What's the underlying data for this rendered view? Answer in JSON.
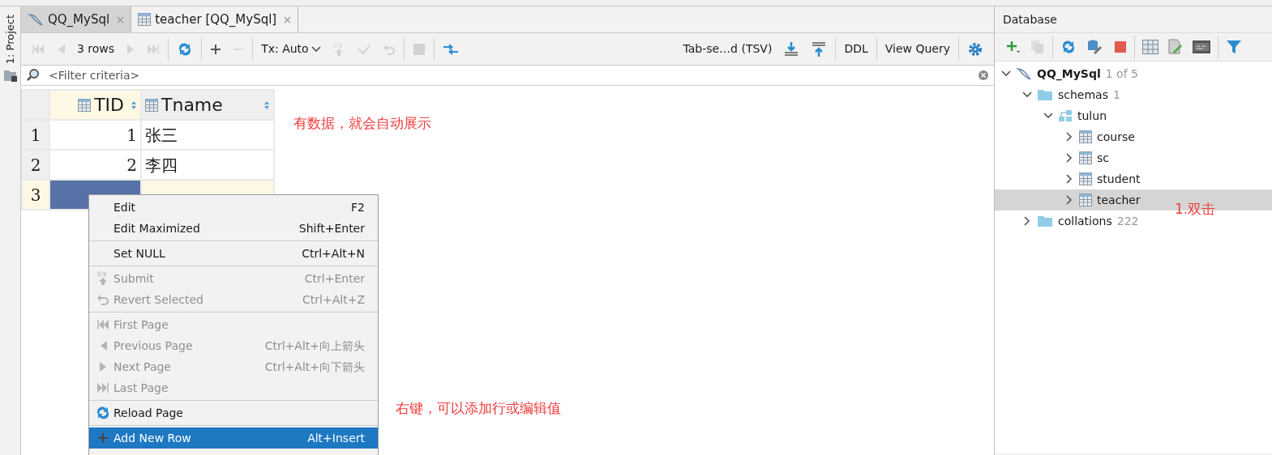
{
  "side_strip": {
    "label": "1: Project"
  },
  "editor_tabs": [
    {
      "label": "QQ_MySql",
      "kind": "datasource",
      "selected": false
    },
    {
      "label": "teacher [QQ_MySql]",
      "kind": "table",
      "selected": true
    }
  ],
  "toolbar": {
    "items": [
      {
        "kind": "first",
        "disabled": true
      },
      {
        "kind": "prev",
        "disabled": true
      },
      {
        "kind": "text",
        "label": "3 rows",
        "disabled": false
      },
      {
        "kind": "next",
        "disabled": true
      },
      {
        "kind": "last",
        "disabled": true
      },
      {
        "kind": "sep"
      },
      {
        "kind": "reload",
        "disabled": false
      },
      {
        "kind": "sep"
      },
      {
        "kind": "plus",
        "disabled": false
      },
      {
        "kind": "minus",
        "disabled": true
      },
      {
        "kind": "sep"
      },
      {
        "kind": "dropdown",
        "label": "Tx: Auto",
        "disabled": false
      },
      {
        "kind": "submit",
        "disabled": true
      },
      {
        "kind": "check",
        "disabled": true
      },
      {
        "kind": "revert",
        "disabled": true
      },
      {
        "kind": "sep"
      },
      {
        "kind": "stop",
        "disabled": true
      },
      {
        "kind": "sep"
      },
      {
        "kind": "compare",
        "disabled": false
      },
      {
        "kind": "spacer"
      },
      {
        "kind": "text",
        "label": "Tab-se…d (TSV)",
        "disabled": false
      },
      {
        "kind": "download",
        "disabled": false
      },
      {
        "kind": "upload",
        "disabled": false
      },
      {
        "kind": "sep"
      },
      {
        "kind": "text",
        "label": "DDL",
        "disabled": false
      },
      {
        "kind": "sep"
      },
      {
        "kind": "text",
        "label": "View Query",
        "disabled": false
      },
      {
        "kind": "sep"
      },
      {
        "kind": "gear",
        "disabled": false
      }
    ]
  },
  "filter": {
    "placeholder": "<Filter criteria>"
  },
  "grid": {
    "columns": [
      {
        "name": "TID",
        "selected": true
      },
      {
        "name": "Tname",
        "selected": false
      }
    ],
    "rows": [
      {
        "number": "1",
        "selected": false,
        "cells": [
          {
            "value": "1",
            "selected": false
          },
          {
            "value": "张三",
            "selected": false
          }
        ]
      },
      {
        "number": "2",
        "selected": false,
        "cells": [
          {
            "value": "2",
            "selected": false
          },
          {
            "value": "李四",
            "selected": false
          }
        ]
      },
      {
        "number": "3",
        "selected": true,
        "cells": [
          {
            "selected": true
          },
          {
            "selected": false
          }
        ]
      }
    ]
  },
  "context_menu": [
    {
      "kind": "plain",
      "label": "Edit",
      "shortcut": "F2",
      "disabled": false,
      "selected": false
    },
    {
      "kind": "plain",
      "label": "Edit Maximized",
      "shortcut": "Shift+Enter",
      "disabled": false,
      "selected": false
    },
    {
      "kind": "separator"
    },
    {
      "kind": "plain",
      "label": "Set NULL",
      "shortcut": "Ctrl+Alt+N",
      "disabled": false,
      "selected": false
    },
    {
      "kind": "separator"
    },
    {
      "kind": "submit",
      "label": "Submit",
      "shortcut": "Ctrl+Enter",
      "disabled": true,
      "selected": false
    },
    {
      "kind": "revert",
      "label": "Revert Selected",
      "shortcut": "Ctrl+Alt+Z",
      "disabled": true,
      "selected": false
    },
    {
      "kind": "separator"
    },
    {
      "kind": "first",
      "label": "First Page",
      "disabled": true,
      "selected": false
    },
    {
      "kind": "prev",
      "label": "Previous Page",
      "shortcut": "Ctrl+Alt+向上箭头",
      "disabled": true,
      "selected": false
    },
    {
      "kind": "next",
      "label": "Next Page",
      "shortcut": "Ctrl+Alt+向下箭头",
      "disabled": true,
      "selected": false
    },
    {
      "kind": "last",
      "label": "Last Page",
      "disabled": true,
      "selected": false
    },
    {
      "kind": "separator"
    },
    {
      "kind": "reload",
      "label": "Reload Page",
      "disabled": false,
      "selected": false
    },
    {
      "kind": "separator"
    },
    {
      "kind": "plus",
      "label": "Add New Row",
      "shortcut": "Alt+Insert",
      "disabled": false,
      "selected": true
    }
  ],
  "database_panel": {
    "title": "Database",
    "toolbar": [
      {
        "kind": "plus",
        "disabled": false
      },
      {
        "kind": "copy",
        "disabled": true
      },
      {
        "kind": "sep"
      },
      {
        "kind": "reload",
        "disabled": false
      },
      {
        "kind": "props",
        "disabled": false
      },
      {
        "kind": "stop",
        "disabled": false
      },
      {
        "kind": "sep"
      },
      {
        "kind": "grid",
        "disabled": false
      },
      {
        "kind": "edit",
        "disabled": false
      },
      {
        "kind": "console",
        "disabled": false
      },
      {
        "kind": "sep"
      },
      {
        "kind": "filter",
        "disabled": false
      }
    ],
    "tree": [
      {
        "kind": "datasource",
        "label": "QQ_MySql",
        "count": "1 of 5",
        "expanded": true,
        "selected": false,
        "children": [
          {
            "kind": "folder",
            "label": "schemas",
            "count": "1",
            "expanded": true,
            "selected": false,
            "children": [
              {
                "kind": "schema",
                "label": "tulun",
                "expanded": true,
                "selected": false,
                "children": [
                  {
                    "kind": "table",
                    "label": "course",
                    "expanded": false,
                    "selected": false
                  },
                  {
                    "kind": "table",
                    "label": "sc",
                    "expanded": false,
                    "selected": false
                  },
                  {
                    "kind": "table",
                    "label": "student",
                    "expanded": false,
                    "selected": false
                  },
                  {
                    "kind": "table",
                    "label": "teacher",
                    "expanded": false,
                    "selected": true
                  }
                ]
              }
            ]
          },
          {
            "kind": "folder",
            "label": "collations",
            "count": "222",
            "expanded": false,
            "selected": false
          }
        ]
      }
    ]
  },
  "annotations": [
    {
      "kind": "grid-note",
      "text": "有数据，就会自动展示"
    },
    {
      "kind": "tree-note",
      "text": "1.双击"
    },
    {
      "kind": "menu-note",
      "text": "右键，可以添加行或编辑值"
    }
  ]
}
